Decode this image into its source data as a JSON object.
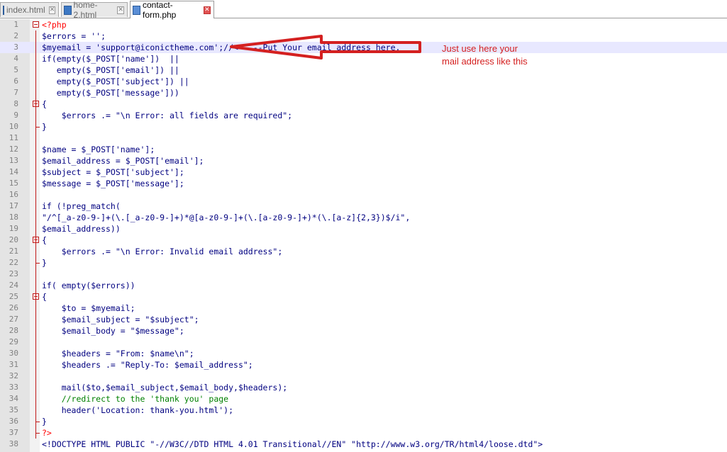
{
  "tabs": [
    {
      "label": "index.html",
      "active": false
    },
    {
      "label": "home-2.html",
      "active": false
    },
    {
      "label": "contact-form.php",
      "active": true
    }
  ],
  "annotation": {
    "line1": "Just use here your",
    "line2": "mail address like this"
  },
  "lines": [
    {
      "n": "1",
      "t": "<?php",
      "fold": "open"
    },
    {
      "n": "2",
      "t": "$errors = '';"
    },
    {
      "n": "3",
      "t": "$myemail = 'support@iconictheme.com';//<-----Put Your email address here.",
      "hl": true
    },
    {
      "n": "4",
      "t": "if(empty($_POST['name'])  ||"
    },
    {
      "n": "5",
      "t": "   empty($_POST['email']) ||"
    },
    {
      "n": "6",
      "t": "   empty($_POST['subject']) ||"
    },
    {
      "n": "7",
      "t": "   empty($_POST['message']))"
    },
    {
      "n": "8",
      "t": "{",
      "fold": "open"
    },
    {
      "n": "9",
      "t": "    $errors .= \"\\n Error: all fields are required\";"
    },
    {
      "n": "10",
      "t": "}"
    },
    {
      "n": "11",
      "t": ""
    },
    {
      "n": "12",
      "t": "$name = $_POST['name'];"
    },
    {
      "n": "13",
      "t": "$email_address = $_POST['email'];"
    },
    {
      "n": "14",
      "t": "$subject = $_POST['subject'];"
    },
    {
      "n": "15",
      "t": "$message = $_POST['message'];"
    },
    {
      "n": "16",
      "t": ""
    },
    {
      "n": "17",
      "t": "if (!preg_match("
    },
    {
      "n": "18",
      "t": "\"/^[_a-z0-9-]+(\\.[_a-z0-9-]+)*@[a-z0-9-]+(\\.[a-z0-9-]+)*(\\.[a-z]{2,3})$/i\","
    },
    {
      "n": "19",
      "t": "$email_address))"
    },
    {
      "n": "20",
      "t": "{",
      "fold": "open"
    },
    {
      "n": "21",
      "t": "    $errors .= \"\\n Error: Invalid email address\";"
    },
    {
      "n": "22",
      "t": "}"
    },
    {
      "n": "23",
      "t": ""
    },
    {
      "n": "24",
      "t": "if( empty($errors))"
    },
    {
      "n": "25",
      "t": "{",
      "fold": "open"
    },
    {
      "n": "26",
      "t": "    $to = $myemail;"
    },
    {
      "n": "27",
      "t": "    $email_subject = \"$subject\";"
    },
    {
      "n": "28",
      "t": "    $email_body = \"$message\";"
    },
    {
      "n": "29",
      "t": ""
    },
    {
      "n": "30",
      "t": "    $headers = \"From: $name\\n\";"
    },
    {
      "n": "31",
      "t": "    $headers .= \"Reply-To: $email_address\";"
    },
    {
      "n": "32",
      "t": ""
    },
    {
      "n": "33",
      "t": "    mail($to,$email_subject,$email_body,$headers);"
    },
    {
      "n": "34",
      "t": "    //redirect to the 'thank you' page"
    },
    {
      "n": "35",
      "t": "    header('Location: thank-you.html');"
    },
    {
      "n": "36",
      "t": "}"
    },
    {
      "n": "37",
      "t": "?>"
    },
    {
      "n": "38",
      "t": "<!DOCTYPE HTML PUBLIC \"-//W3C//DTD HTML 4.01 Transitional//EN\" \"http://www.w3.org/TR/html4/loose.dtd\">"
    }
  ],
  "colors": {
    "accent": "#d42020",
    "foldmark": "#c01818",
    "current_line": "#e8e8ff"
  }
}
